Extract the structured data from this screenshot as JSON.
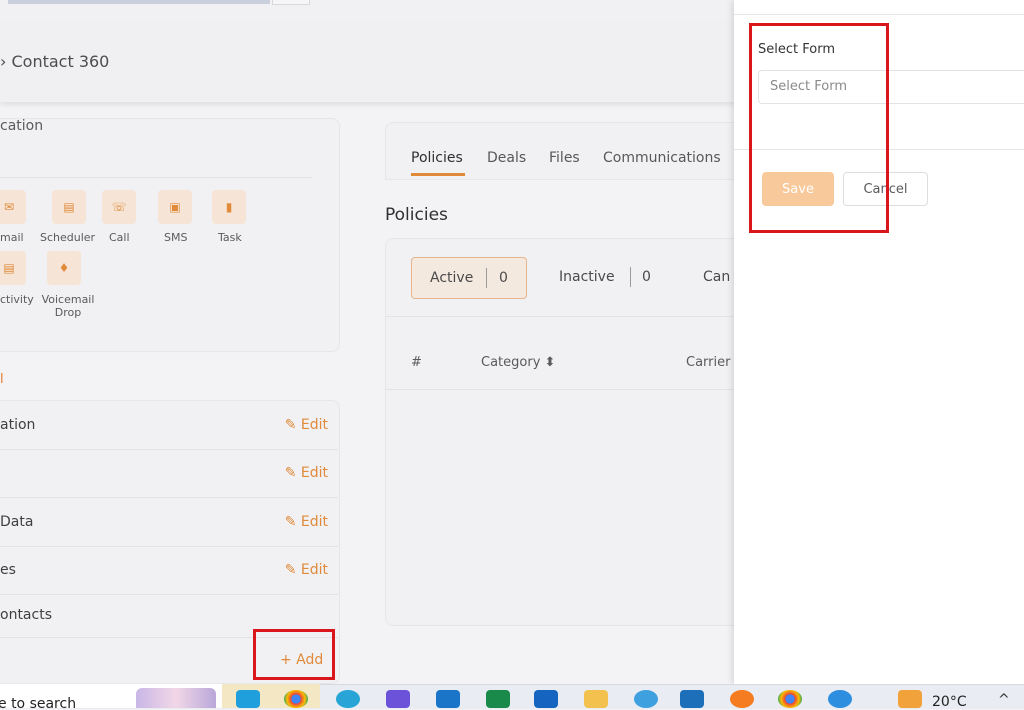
{
  "header": {
    "breadcrumb": "› Contact 360"
  },
  "communication": {
    "title": "cation",
    "actions": [
      {
        "label": "mail",
        "icon": "email-icon",
        "glyph": "✉"
      },
      {
        "label": "Scheduler",
        "icon": "calendar-icon",
        "glyph": "▤"
      },
      {
        "label": "Call",
        "icon": "phone-icon",
        "glyph": "☏"
      },
      {
        "label": "SMS",
        "icon": "sms-icon",
        "glyph": "▣"
      },
      {
        "label": "Task",
        "icon": "task-icon",
        "glyph": "▮"
      },
      {
        "label": "ctivity",
        "icon": "activity-icon",
        "glyph": "▤"
      },
      {
        "label": "Voicemail Drop",
        "icon": "microphone-icon",
        "glyph": "♦"
      }
    ]
  },
  "sections": {
    "mark": "l",
    "rows": [
      {
        "label": "ation",
        "edit": "Edit"
      },
      {
        "label": "",
        "edit": "Edit"
      },
      {
        "label": "Data",
        "edit": "Edit"
      },
      {
        "label": "es",
        "edit": "Edit"
      },
      {
        "label": "ontacts",
        "edit": ""
      }
    ],
    "add_label": "+ Add"
  },
  "tabs": [
    "Policies",
    "Deals",
    "Files",
    "Communications"
  ],
  "policies": {
    "title": "Policies",
    "filters": [
      {
        "label": "Active",
        "count": "0"
      },
      {
        "label": "Inactive",
        "count": "0"
      },
      {
        "label": "Can",
        "count": ""
      }
    ],
    "columns": [
      "#",
      "Category ⬍",
      "Carrier"
    ]
  },
  "drawer": {
    "label": "Select Form",
    "placeholder": "Select Form",
    "save": "Save",
    "cancel": "Cancel"
  },
  "taskbar": {
    "search": "e to search",
    "temperature": "20°C",
    "chevron": "^"
  },
  "colors": {
    "accent": "#e08a3a",
    "highlight": "#d9161b",
    "save_disabled": "#f8c99b"
  }
}
